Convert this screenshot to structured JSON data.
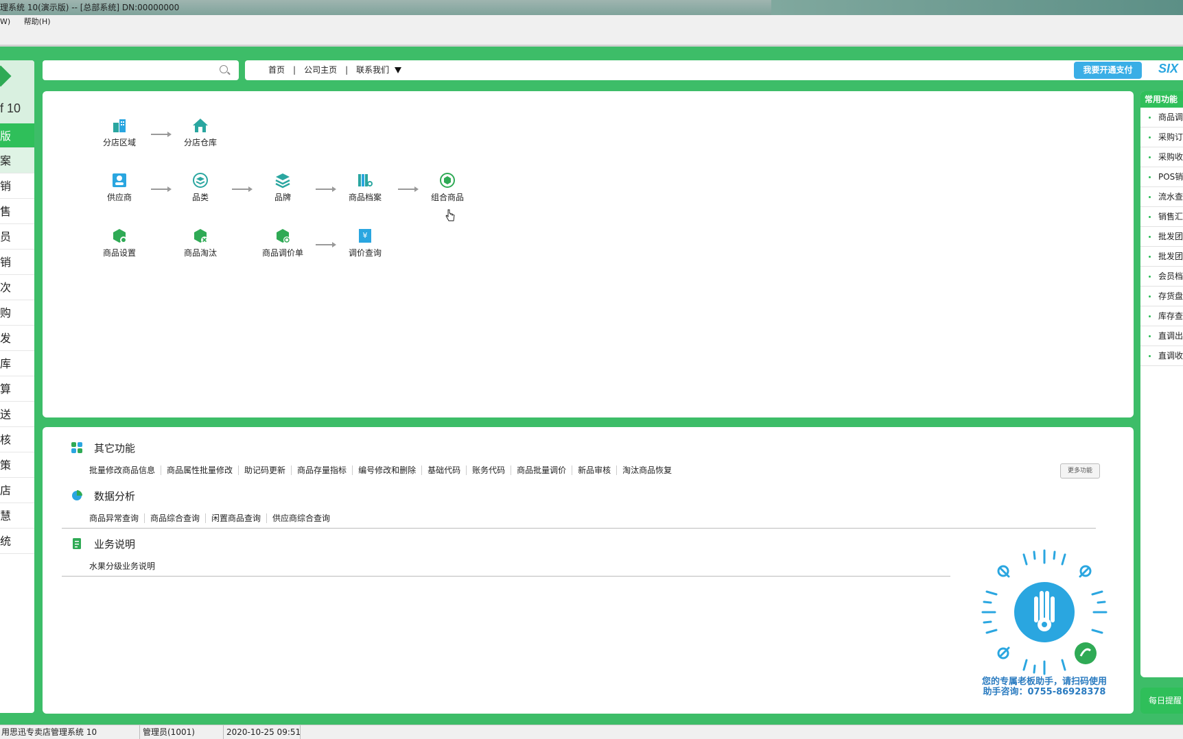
{
  "window": {
    "title": "理系统 10(演示版) -- [总部系统] DN:00000000"
  },
  "menubar": {
    "items": [
      "W)",
      "帮助(H)"
    ]
  },
  "sidebar": {
    "version": "f 10",
    "items": [
      "版",
      "案",
      "销",
      "售",
      "员",
      "销",
      "次",
      "购",
      "发",
      "库",
      "算",
      "送",
      "核",
      "策",
      "店",
      "慧",
      "统"
    ]
  },
  "topnav": {
    "search_placeholder": "",
    "links": [
      "首页",
      "公司主页",
      "联系我们"
    ],
    "pay_button": "我要开通支付",
    "brand": "SIX"
  },
  "flow": {
    "row1": [
      "分店区域",
      "分店仓库"
    ],
    "row2": [
      "供应商",
      "品类",
      "品牌",
      "商品档案",
      "组合商品"
    ],
    "row3": [
      "商品设置",
      "商品淘汰",
      "商品调价单",
      "调价查询"
    ]
  },
  "sections": {
    "other": {
      "title": "其它功能",
      "links": [
        "批量修改商品信息",
        "商品属性批量修改",
        "助记码更新",
        "商品存量指标",
        "编号修改和删除",
        "基础代码",
        "账务代码",
        "商品批量调价",
        "新品审核",
        "淘汰商品恢复"
      ],
      "more_button": "更多功能"
    },
    "analysis": {
      "title": "数据分析",
      "links": [
        "商品异常查询",
        "商品综合查询",
        "闲置商品查询",
        "供应商综合查询"
      ]
    },
    "business": {
      "title": "业务说明",
      "links": [
        "水果分级业务说明"
      ]
    }
  },
  "qr": {
    "line1": "您的专属老板助手，请扫码使用",
    "line2": "助手咨询：0755-86928378"
  },
  "rightpanel": {
    "title": "常用功能",
    "items": [
      "商品调",
      "采购订",
      "采购收",
      "POS销售",
      "流水查",
      "销售汇",
      "批发团",
      "批发团",
      "会员档",
      "存货盘",
      "库存查",
      "直调出",
      "直调收"
    ],
    "remind": "每日提醒"
  },
  "statusbar": {
    "app": "用思迅专卖店管理系统 10",
    "user": "管理员(1001)",
    "datetime": "2020-10-25 09:51"
  },
  "colors": {
    "accent": "#3dbd68",
    "active": "#2fbf5a",
    "icon": "#2aa6a0",
    "pay": "#3aaee6"
  }
}
